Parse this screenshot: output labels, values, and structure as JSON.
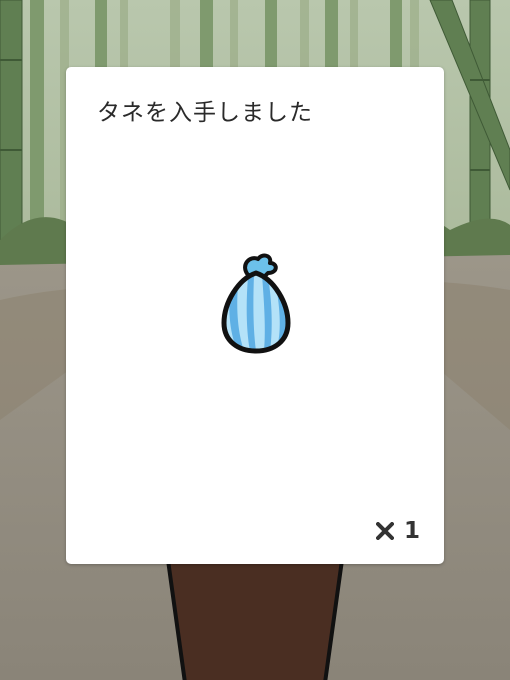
{
  "dialog": {
    "title": "タネを入手しました",
    "item_icon": "seed-bag-icon",
    "quantity_prefix_icon": "multiply-icon",
    "quantity": "1"
  },
  "colors": {
    "dialog_background": "#ffffff",
    "seed_bag_light": "#a8dcf5",
    "seed_bag_stripe": "#5fb0e5",
    "outline": "#111111",
    "bamboo": "#6d8a5e",
    "pot": "#4a2e22"
  }
}
